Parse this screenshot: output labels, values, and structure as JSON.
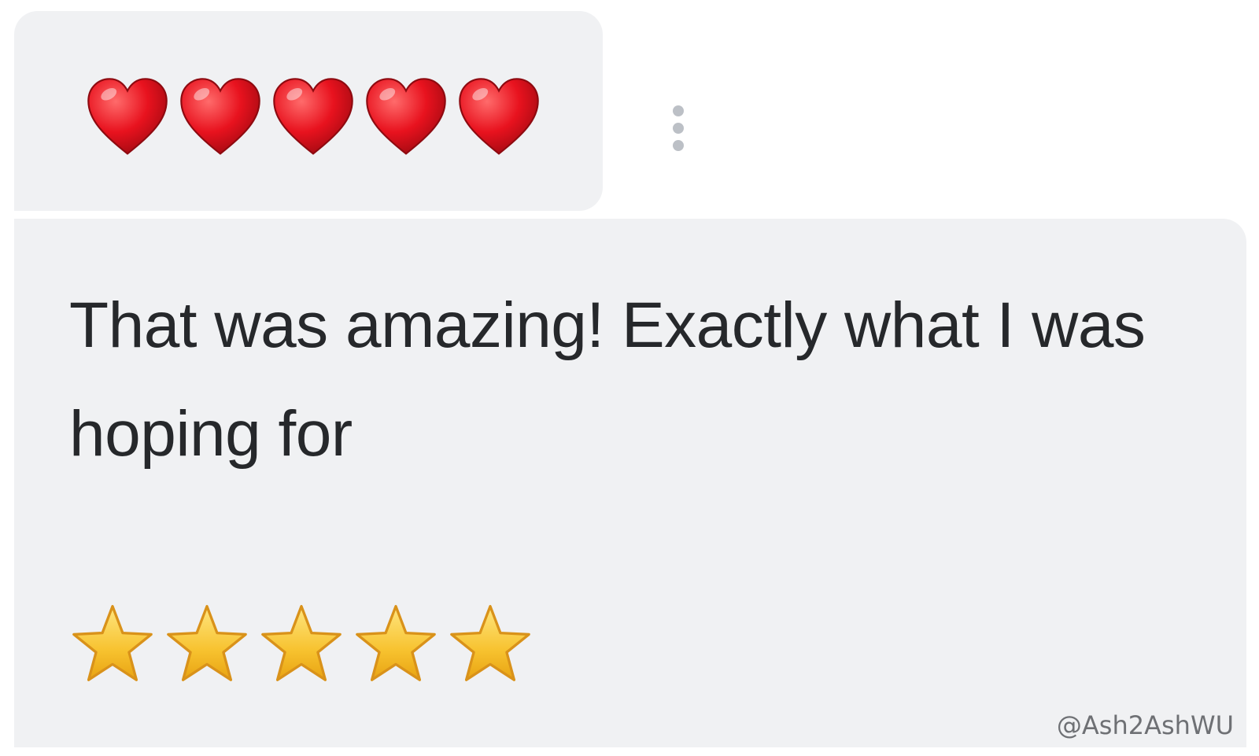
{
  "reaction": {
    "icon": "red-heart-icon",
    "count": 5,
    "color": "#e8121e"
  },
  "message": {
    "text": "That was amazing! Exactly what I was hoping for",
    "rating": {
      "icon": "star-icon",
      "value": 5,
      "max": 5,
      "color": "#f7c22f"
    }
  },
  "more_options": {
    "icon": "vertical-ellipsis-icon"
  },
  "watermark": "@Ash2AshWU",
  "colors": {
    "bubble_background": "#f0f1f3",
    "text": "#26282b"
  }
}
